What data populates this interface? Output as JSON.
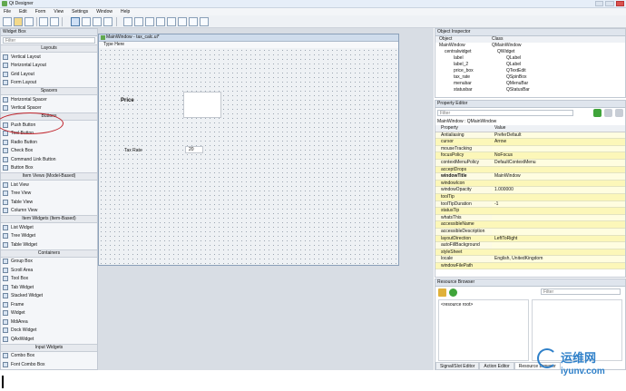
{
  "app": {
    "title": "Qt Designer"
  },
  "menu": [
    "File",
    "Edit",
    "Form",
    "View",
    "Settings",
    "Window",
    "Help"
  ],
  "widget_box": {
    "title": "Widget Box",
    "filter_placeholder": "Filter",
    "sections": [
      {
        "title": "Layouts",
        "items": [
          "Vertical Layout",
          "Horizontal Layout",
          "Grid Layout",
          "Form Layout"
        ]
      },
      {
        "title": "Spacers",
        "items": [
          "Horizontal Spacer",
          "Vertical Spacer"
        ]
      },
      {
        "title": "Buttons",
        "items": [
          "Push Button",
          "Tool Button",
          "Radio Button",
          "Check Box",
          "Command Link Button",
          "Button Box"
        ]
      },
      {
        "title": "Item Views (Model-Based)",
        "items": [
          "List View",
          "Tree View",
          "Table View",
          "Column View"
        ]
      },
      {
        "title": "Item Widgets (Item-Based)",
        "items": [
          "List Widget",
          "Tree Widget",
          "Table Widget"
        ]
      },
      {
        "title": "Containers",
        "items": [
          "Group Box",
          "Scroll Area",
          "Tool Box",
          "Tab Widget",
          "Stacked Widget",
          "Frame",
          "Widget",
          "MdiArea",
          "Dock Widget",
          "QAxWidget"
        ]
      },
      {
        "title": "Input Widgets",
        "items": [
          "Combo Box",
          "Font Combo Box"
        ]
      }
    ]
  },
  "form": {
    "title": "MainWindow - tax_calc.ui*",
    "menu_placeholder": "Type Here",
    "price_label": "Price",
    "tax_rate_label": "Tax Rate",
    "tax_rate_value": "20"
  },
  "object_inspector": {
    "title": "Object Inspector",
    "headers": [
      "Object",
      "Class"
    ],
    "rows": [
      {
        "object": "MainWindow",
        "class": "QMainWindow"
      },
      {
        "object": "centralwidget",
        "class": "QWidget"
      },
      {
        "object": "label",
        "class": "QLabel"
      },
      {
        "object": "label_2",
        "class": "QLabel"
      },
      {
        "object": "price_box",
        "class": "QTextEdit"
      },
      {
        "object": "tax_rate",
        "class": "QSpinBox"
      },
      {
        "object": "menubar",
        "class": "QMenuBar"
      },
      {
        "object": "statusbar",
        "class": "QStatusBar"
      }
    ]
  },
  "property_editor": {
    "title": "Property Editor",
    "filter_placeholder": "Filter",
    "context": "MainWindow : QMainWindow",
    "headers": [
      "Property",
      "Value"
    ],
    "rows": [
      {
        "name": "Antialiasing",
        "value": "PreferDefault"
      },
      {
        "name": "cursor",
        "value": "Arrow"
      },
      {
        "name": "mouseTracking",
        "value": ""
      },
      {
        "name": "focusPolicy",
        "value": "NoFocus"
      },
      {
        "name": "contextMenuPolicy",
        "value": "DefaultContextMenu"
      },
      {
        "name": "acceptDrops",
        "value": ""
      },
      {
        "name": "windowTitle",
        "value": "MainWindow"
      },
      {
        "name": "windowIcon",
        "value": ""
      },
      {
        "name": "windowOpacity",
        "value": "1.000000"
      },
      {
        "name": "toolTip",
        "value": ""
      },
      {
        "name": "toolTipDuration",
        "value": "-1"
      },
      {
        "name": "statusTip",
        "value": ""
      },
      {
        "name": "whatsThis",
        "value": ""
      },
      {
        "name": "accessibleName",
        "value": ""
      },
      {
        "name": "accessibleDescription",
        "value": ""
      },
      {
        "name": "layoutDirection",
        "value": "LeftToRight"
      },
      {
        "name": "autoFillBackground",
        "value": ""
      },
      {
        "name": "styleSheet",
        "value": ""
      },
      {
        "name": "locale",
        "value": "English, UnitedKingdom"
      },
      {
        "name": "windowFilePath",
        "value": ""
      }
    ]
  },
  "resource_browser": {
    "title": "Resource Browser",
    "filter_placeholder": "Filter",
    "root": "<resource root>",
    "tabs": [
      "Signal/Slot Editor",
      "Action Editor",
      "Resource Browser"
    ]
  },
  "watermark": {
    "site": "iyunv.com",
    "cn": "运维网"
  }
}
